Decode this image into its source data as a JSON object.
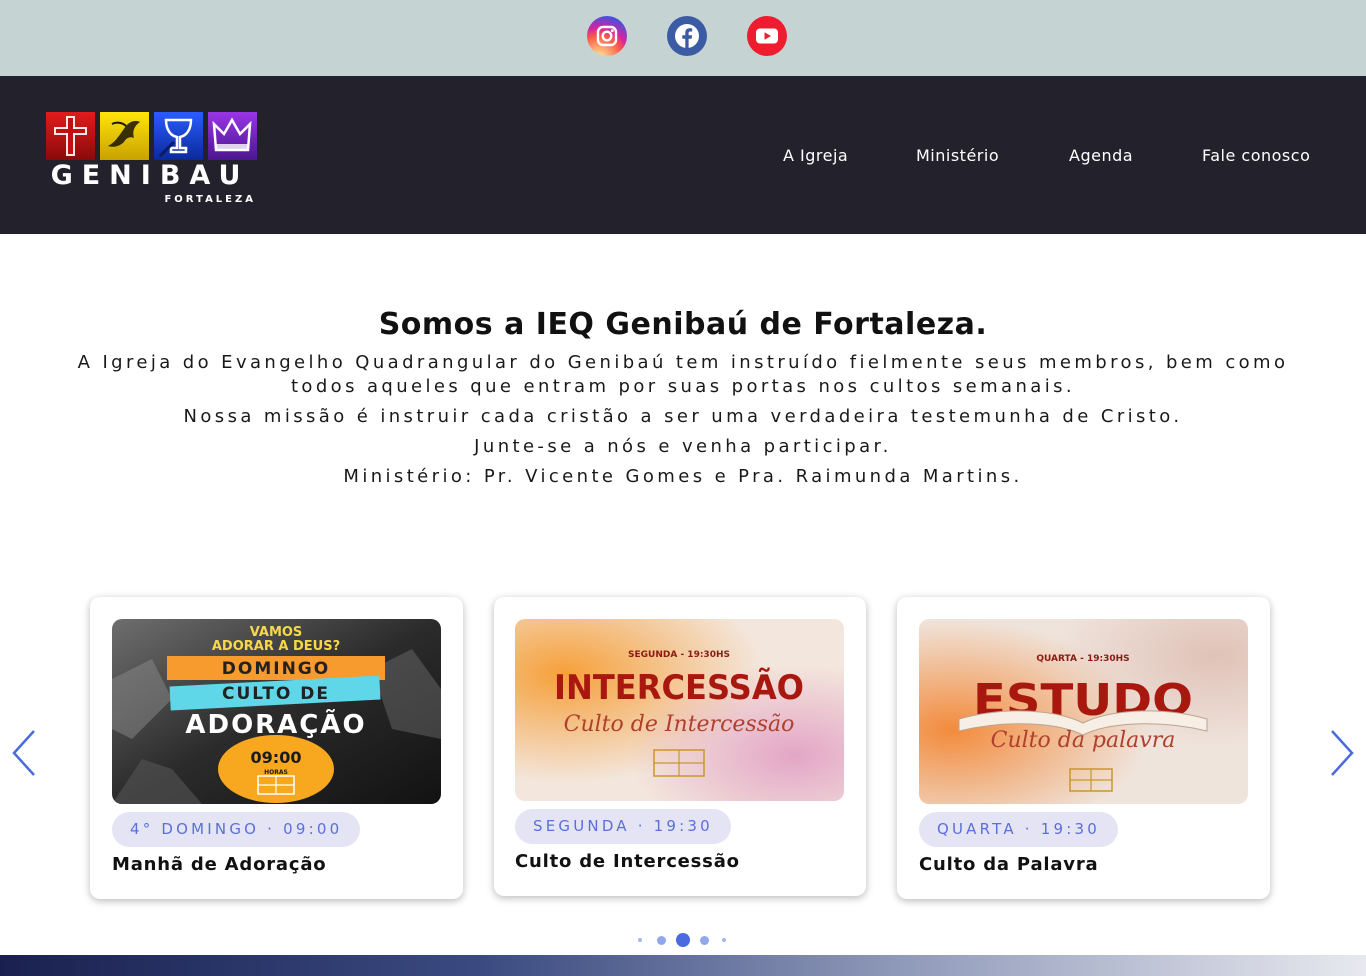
{
  "social": {
    "items": [
      {
        "name": "instagram",
        "icon": "instagram-icon",
        "color": "#d6249f"
      },
      {
        "name": "facebook",
        "icon": "facebook-icon",
        "color": "#3b5ba5"
      },
      {
        "name": "youtube",
        "icon": "youtube-icon",
        "color": "#ee1c2e"
      }
    ],
    "bar_color": "#c5d3d3"
  },
  "header": {
    "background": "#23222c",
    "logo": {
      "name": "GENIBAU",
      "city": "FORTALEZA"
    },
    "nav": [
      "A Igreja",
      "Ministério",
      "Agenda",
      "Fale conosco"
    ]
  },
  "intro": {
    "title": "Somos a IEQ Genibaú de Fortaleza.",
    "paragraphs": [
      "A Igreja do Evangelho Quadrangular do Genibaú tem instruído fielmente seus membros, bem como todos aqueles que entram por suas portas nos cultos semanais.",
      "Nossa missão é instruir cada cristão a ser uma verdadeira testemunha de Cristo.",
      "Junte-se a nós e venha participar.",
      "Ministério: Pr. Vicente Gomes e Pra. Raimunda Martins."
    ]
  },
  "carousel": {
    "cards": [
      {
        "badge": "4° DOMINGO · 09:00",
        "title": "Manhã de Adoração",
        "image": {
          "line1": "VAMOS",
          "line2": "ADORAR A DEUS?",
          "line3": "DOMINGO",
          "line4": "CULTO DE",
          "line5": "ADORAÇÃO",
          "time": "09:00",
          "time_unit": "HORAS"
        }
      },
      {
        "badge": "SEGUNDA · 19:30",
        "title": "Culto de Intercessão",
        "image": {
          "top": "SEGUNDA - 19:30HS",
          "headline": "INTERCESSÃO",
          "script": "Culto de Intercessão"
        }
      },
      {
        "badge": "QUARTA · 19:30",
        "title": "Culto da Palavra",
        "image": {
          "top": "QUARTA - 19:30HS",
          "headline": "ESTUDO",
          "script": "Culto da palavra"
        }
      }
    ],
    "prev_icon": "chevron-left-icon",
    "next_icon": "chevron-right-icon",
    "accent": "#4a6be0",
    "pagination": {
      "count": 5,
      "active": 3
    }
  }
}
